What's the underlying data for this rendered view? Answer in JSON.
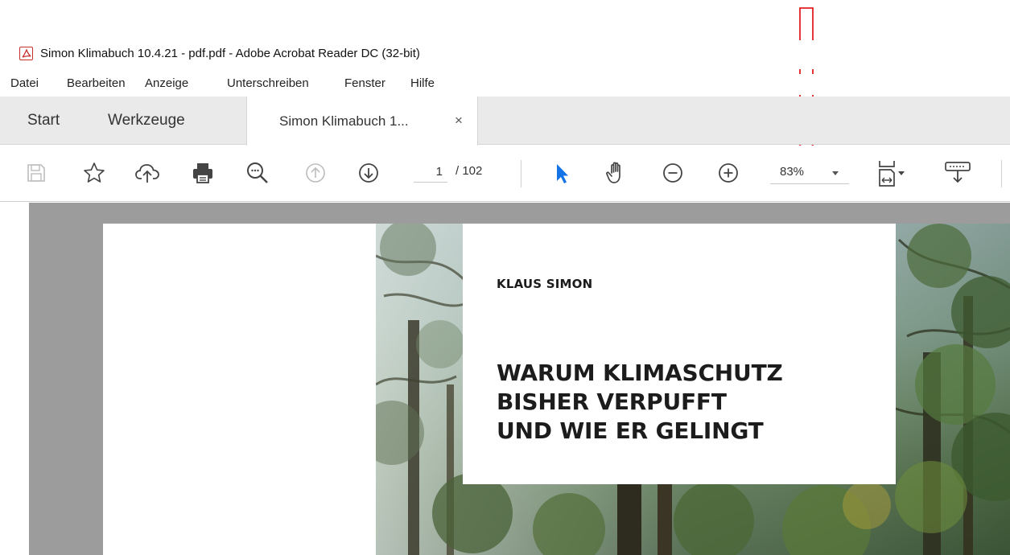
{
  "window": {
    "title": "Simon Klimabuch 10.4.21 - pdf.pdf - Adobe Acrobat Reader DC (32-bit)",
    "icon": "acrobat-icon"
  },
  "menu": {
    "items": [
      "Datei",
      "Bearbeiten",
      "Anzeige",
      "Unterschreiben",
      "Fenster",
      "Hilfe"
    ]
  },
  "tabs": {
    "start": "Start",
    "tools": "Werkzeuge",
    "document": "Simon Klimabuch 1...",
    "close_symbol": "×"
  },
  "toolbar": {
    "icons": [
      "save-icon",
      "bookmark-star-icon",
      "upload-cloud-icon",
      "print-icon",
      "search-zoom-icon",
      "page-up-icon",
      "page-down-icon",
      "select-cursor-icon",
      "hand-tool-icon",
      "zoom-out-icon",
      "zoom-in-icon",
      "fit-page-icon",
      "scrolling-mode-icon"
    ],
    "page_current": "1",
    "page_total": "/ 102",
    "zoom": "83%"
  },
  "document": {
    "author": "KLAUS SIMON",
    "title_lines": [
      "WARUM KLIMASCHUTZ",
      "BISHER VERPUFFT",
      "UND WIE ER GELINGT"
    ]
  },
  "colors": {
    "accent_blue": "#1473e6",
    "annotation_red": "#e02020",
    "acrobat_red": "#c8302c"
  }
}
